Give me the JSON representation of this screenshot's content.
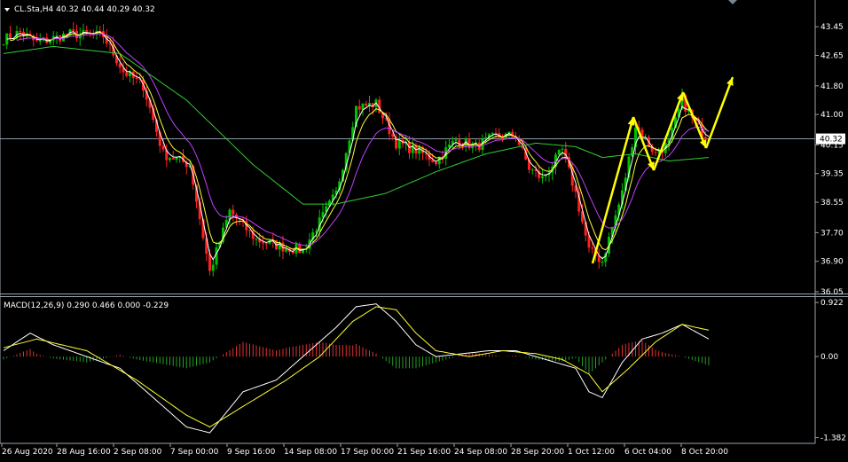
{
  "chart_data": [
    {
      "type": "candlestick",
      "symbol_header": "CL.Sta,H4  40.32 40.44 40.29 40.32",
      "y_ticks": [
        "43.45",
        "42.65",
        "41.80",
        "41.00",
        "40.15",
        "39.35",
        "38.55",
        "37.70",
        "36.90",
        "36.05"
      ],
      "y_tick_values": [
        43.45,
        42.65,
        41.8,
        41.0,
        40.15,
        39.35,
        38.55,
        37.7,
        36.9,
        36.05
      ],
      "ylim": [
        36.05,
        43.85
      ],
      "current_price": 40.32,
      "current_price_label": "40.32",
      "colors": {
        "bull": "#00c000",
        "bear": "#ff2020",
        "ma_fast": "#ffffff",
        "ma_mid": "#ffff33",
        "ma_slow": "#c040ff",
        "ma_long": "#33cc33",
        "arrows": "#ffff00",
        "price_line": "#8a9aa8"
      },
      "anchors": [
        [
          0,
          43.1
        ],
        [
          5,
          43.3
        ],
        [
          10,
          43.0
        ],
        [
          20,
          43.25
        ],
        [
          30,
          43.2
        ],
        [
          36,
          42.2
        ],
        [
          42,
          41.8
        ],
        [
          48,
          39.9
        ],
        [
          56,
          39.6
        ],
        [
          62,
          36.6
        ],
        [
          68,
          38.3
        ],
        [
          72,
          37.9
        ],
        [
          76,
          37.5
        ],
        [
          84,
          37.3
        ],
        [
          90,
          37.2
        ],
        [
          100,
          38.8
        ],
        [
          106,
          41.2
        ],
        [
          112,
          41.3
        ],
        [
          118,
          40.2
        ],
        [
          124,
          40.0
        ],
        [
          130,
          39.7
        ],
        [
          136,
          40.3
        ],
        [
          142,
          40.1
        ],
        [
          148,
          40.4
        ],
        [
          154,
          40.4
        ],
        [
          158,
          39.5
        ],
        [
          162,
          39.2
        ],
        [
          168,
          40.0
        ],
        [
          172,
          38.8
        ],
        [
          176,
          37.2
        ],
        [
          180,
          36.9
        ],
        [
          186,
          38.8
        ],
        [
          190,
          40.7
        ],
        [
          196,
          39.9
        ],
        [
          200,
          40.2
        ],
        [
          204,
          41.4
        ],
        [
          208,
          40.7
        ],
        [
          212,
          40.32
        ]
      ],
      "ma_long_pts": [
        [
          0,
          42.7
        ],
        [
          15,
          42.9
        ],
        [
          35,
          42.7
        ],
        [
          55,
          41.4
        ],
        [
          75,
          39.6
        ],
        [
          90,
          38.5
        ],
        [
          100,
          38.5
        ],
        [
          115,
          38.8
        ],
        [
          130,
          39.4
        ],
        [
          145,
          39.9
        ],
        [
          160,
          40.2
        ],
        [
          172,
          40.1
        ],
        [
          180,
          39.8
        ],
        [
          190,
          39.9
        ],
        [
          200,
          39.7
        ],
        [
          212,
          39.8
        ]
      ],
      "arrows": [
        [
          [
            668,
            297
          ],
          [
            714,
            132
          ]
        ],
        [
          [
            714,
            132
          ],
          [
            737,
            192
          ]
        ],
        [
          [
            737,
            192
          ],
          [
            770,
            104
          ]
        ],
        [
          [
            770,
            104
          ],
          [
            796,
            167
          ]
        ],
        [
          [
            796,
            167
          ],
          [
            826,
            87
          ]
        ]
      ],
      "x_ticks": [
        "26 Aug 2020",
        "28 Aug 16:00",
        "2 Sep 08:00",
        "7 Sep 00:00",
        "9 Sep 16:00",
        "14 Sep 08:00",
        "17 Sep 00:00",
        "21 Sep 16:00",
        "24 Sep 08:00",
        "28 Sep 20:00",
        "1 Oct 12:00",
        "6 Oct 04:00",
        "8 Oct 20:00"
      ]
    },
    {
      "type": "macd",
      "header": "MACD(12,26,9) 0.290 0.466 0.000 -0.229",
      "y_ticks": [
        "0.922",
        "0.00",
        "-1.382"
      ],
      "y_tick_values": [
        0.922,
        0.0,
        -1.382
      ],
      "ylim": [
        -1.45,
        1.0
      ],
      "macd_pts": [
        [
          0,
          0.1
        ],
        [
          8,
          0.4
        ],
        [
          15,
          0.2
        ],
        [
          25,
          0.0
        ],
        [
          35,
          -0.2
        ],
        [
          45,
          -0.7
        ],
        [
          55,
          -1.2
        ],
        [
          62,
          -1.3
        ],
        [
          72,
          -0.6
        ],
        [
          82,
          -0.4
        ],
        [
          92,
          0.1
        ],
        [
          100,
          0.5
        ],
        [
          106,
          0.85
        ],
        [
          112,
          0.9
        ],
        [
          118,
          0.6
        ],
        [
          124,
          0.2
        ],
        [
          130,
          0.0
        ],
        [
          138,
          0.05
        ],
        [
          146,
          0.1
        ],
        [
          154,
          0.1
        ],
        [
          160,
          0.0
        ],
        [
          166,
          -0.1
        ],
        [
          172,
          -0.2
        ],
        [
          176,
          -0.6
        ],
        [
          180,
          -0.7
        ],
        [
          186,
          -0.1
        ],
        [
          192,
          0.3
        ],
        [
          198,
          0.4
        ],
        [
          204,
          0.55
        ],
        [
          212,
          0.3
        ]
      ],
      "signal_pts": [
        [
          0,
          0.15
        ],
        [
          10,
          0.3
        ],
        [
          25,
          0.1
        ],
        [
          40,
          -0.4
        ],
        [
          55,
          -1.0
        ],
        [
          62,
          -1.2
        ],
        [
          72,
          -0.85
        ],
        [
          85,
          -0.4
        ],
        [
          95,
          0.0
        ],
        [
          105,
          0.6
        ],
        [
          112,
          0.85
        ],
        [
          118,
          0.8
        ],
        [
          124,
          0.4
        ],
        [
          130,
          0.1
        ],
        [
          140,
          0.0
        ],
        [
          150,
          0.1
        ],
        [
          160,
          0.05
        ],
        [
          168,
          -0.05
        ],
        [
          176,
          -0.3
        ],
        [
          180,
          -0.6
        ],
        [
          188,
          -0.2
        ],
        [
          196,
          0.25
        ],
        [
          204,
          0.55
        ],
        [
          212,
          0.45
        ]
      ]
    }
  ]
}
